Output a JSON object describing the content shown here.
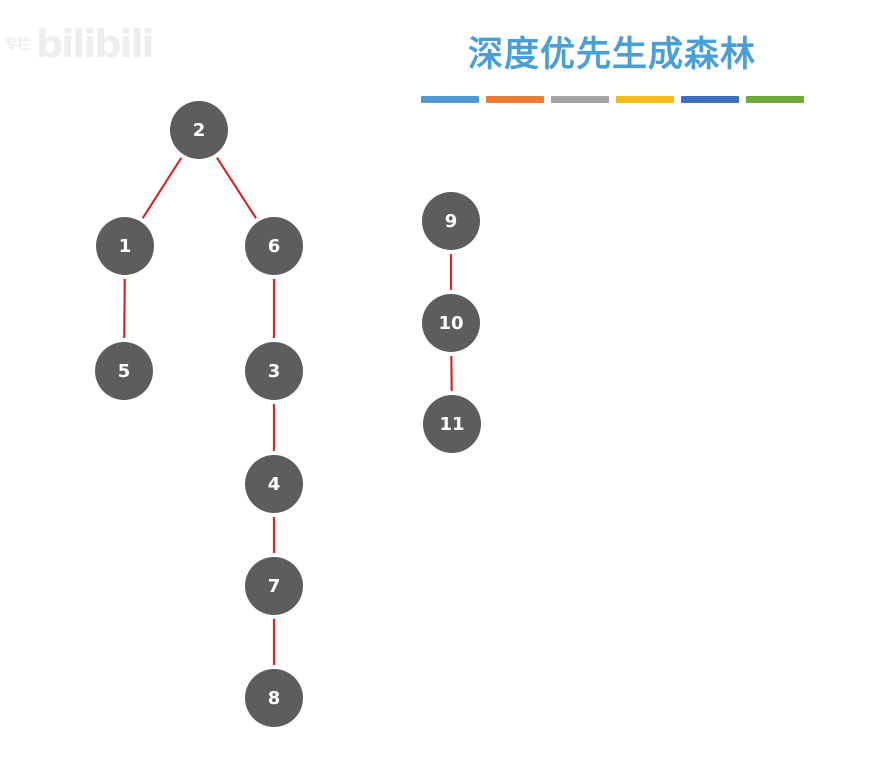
{
  "title": "深度优先生成森林",
  "watermark": {
    "small_text": "专栏",
    "logo_text": "bilibili"
  },
  "colors": {
    "title": "#4a9fd6",
    "node_fill": "#5d5d5d",
    "node_text": "#ffffff",
    "edge": "#d42828",
    "bar_segments": [
      "#4f98d1",
      "#ec7c33",
      "#a3a3a3",
      "#f4bc1d",
      "#3f6fc0",
      "#6caa3c"
    ]
  },
  "forest": {
    "nodes": [
      {
        "id": "2",
        "label": "2"
      },
      {
        "id": "1",
        "label": "1"
      },
      {
        "id": "6",
        "label": "6"
      },
      {
        "id": "5",
        "label": "5"
      },
      {
        "id": "3",
        "label": "3"
      },
      {
        "id": "4",
        "label": "4"
      },
      {
        "id": "7",
        "label": "7"
      },
      {
        "id": "8",
        "label": "8"
      },
      {
        "id": "9",
        "label": "9"
      },
      {
        "id": "10",
        "label": "10"
      },
      {
        "id": "11",
        "label": "11"
      }
    ],
    "edges": [
      {
        "from": "2",
        "to": "1"
      },
      {
        "from": "2",
        "to": "6"
      },
      {
        "from": "1",
        "to": "5"
      },
      {
        "from": "6",
        "to": "3"
      },
      {
        "from": "3",
        "to": "4"
      },
      {
        "from": "4",
        "to": "7"
      },
      {
        "from": "7",
        "to": "8"
      },
      {
        "from": "9",
        "to": "10"
      },
      {
        "from": "10",
        "to": "11"
      }
    ]
  }
}
